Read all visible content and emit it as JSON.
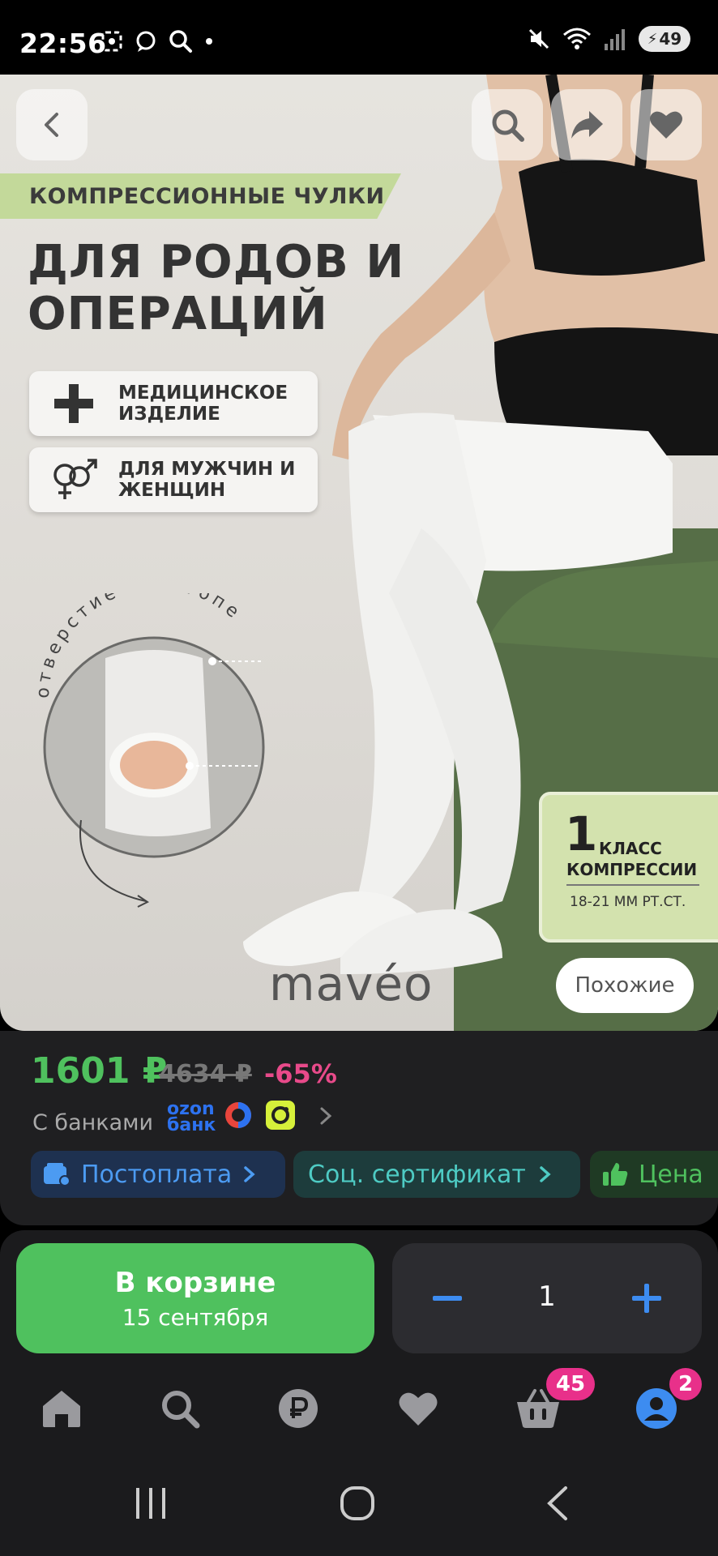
{
  "status_bar": {
    "time": "22:56",
    "battery": "49"
  },
  "product_image": {
    "banner": "КОМПРЕССИОННЫЕ ЧУЛКИ",
    "title_line1": "ДЛЯ РОДОВ И",
    "title_line2": "ОПЕРАЦИЙ",
    "features": [
      {
        "line1": "МЕДИЦИНСКОЕ",
        "line2": "ИЗДЕЛИЕ",
        "icon": "plus-icon"
      },
      {
        "line1": "ДЛЯ МУЖЧИН И",
        "line2": "ЖЕНЩИН",
        "icon": "gender-icon"
      }
    ],
    "hole_caption": "отверстие на стопе",
    "compression_number": "1",
    "compression_line1": "КЛАСС",
    "compression_line2": "КОМПРЕССИИ",
    "compression_pressure": "18-21 ММ РТ.СТ.",
    "brand": "mavéo",
    "similar_label": "Похожие"
  },
  "price": {
    "current": "1601 ₽",
    "old": "4634 ₽",
    "discount": "-65%",
    "banks_label": "С банками",
    "ozon_bank_line1": "ozon",
    "ozon_bank_line2": "банк"
  },
  "chips": [
    {
      "label": "Постоплата",
      "bg": "#1e3150",
      "color": "#4c9bf2"
    },
    {
      "label": "Соц. сертификат",
      "bg": "#1d3c3c",
      "color": "#4ecbc4"
    },
    {
      "label": "Цена",
      "bg": "#1f3a24",
      "color": "#4fc15e"
    }
  ],
  "cart": {
    "button_line1": "В корзине",
    "button_line2": "15 сентября",
    "quantity": "1"
  },
  "nav": {
    "cart_badge": "45",
    "profile_badge": "2"
  },
  "colors": {
    "accent_green": "#4fc15e",
    "accent_blue": "#3d8cf0",
    "badge_pink": "#e8308a",
    "discount_pink": "#e84a8a"
  }
}
